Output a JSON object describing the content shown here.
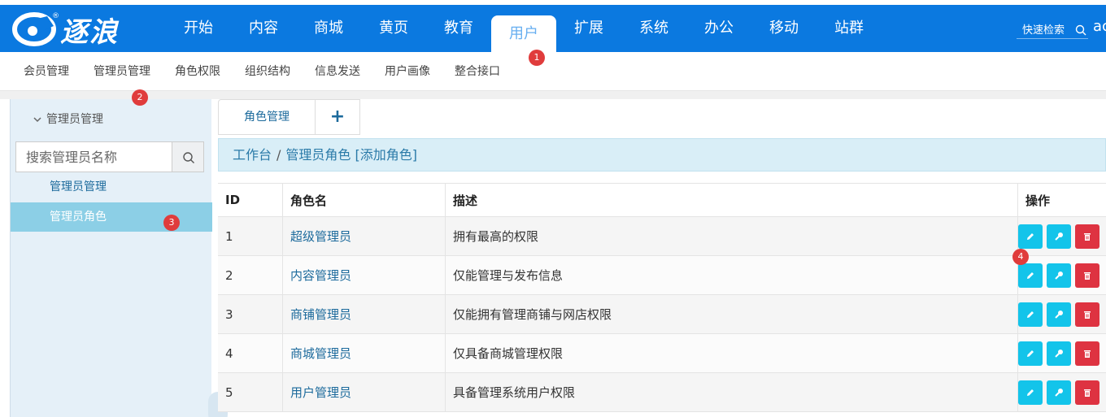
{
  "logo": {
    "text": "逐浪"
  },
  "nav": {
    "items": [
      "开始",
      "内容",
      "商城",
      "黄页",
      "教育",
      "用户",
      "扩展",
      "系统",
      "办公",
      "移动",
      "站群"
    ],
    "active": "用户"
  },
  "quick_search": {
    "label": "快速检索",
    "user_truncated": "ac"
  },
  "subnav": {
    "items": [
      "会员管理",
      "管理员管理",
      "角色权限",
      "组织结构",
      "信息发送",
      "用户画像",
      "整合接口"
    ]
  },
  "badges": {
    "b1": "1",
    "b2": "2",
    "b3": "3",
    "b4": "4"
  },
  "sidebar": {
    "heading": "管理员管理",
    "search_placeholder": "搜索管理员名称",
    "items": [
      {
        "label": "管理员管理",
        "active": false
      },
      {
        "label": "管理员角色",
        "active": true
      }
    ]
  },
  "tabs": {
    "current": "角色管理",
    "add": "+"
  },
  "breadcrumb": {
    "home": "工作台",
    "separator": "/",
    "current": "管理员角色 [添加角色]"
  },
  "table": {
    "headers": {
      "id": "ID",
      "name": "角色名",
      "desc": "描述",
      "ops": "操作"
    },
    "rows": [
      {
        "id": "1",
        "name": "超级管理员",
        "desc": "拥有最高的权限"
      },
      {
        "id": "2",
        "name": "内容管理员",
        "desc": "仅能管理与发布信息"
      },
      {
        "id": "3",
        "name": "商铺管理员",
        "desc": "仅能拥有管理商铺与网店权限"
      },
      {
        "id": "4",
        "name": "商城管理员",
        "desc": "仅具备商城管理权限"
      },
      {
        "id": "5",
        "name": "用户管理员",
        "desc": "具备管理系统用户权限"
      }
    ]
  },
  "colors": {
    "topbar": "#0b79e0",
    "sidebar": "#e5f0f8",
    "active_side": "#8ccfe6",
    "breadcrumb_bg": "#d9eef7",
    "op_cyan": "#13c4ea",
    "op_red": "#de3341",
    "badge": "#e03c3c"
  },
  "icons": [
    "logo-icon",
    "search-icon",
    "chevron-down-icon",
    "pencil-icon",
    "key-icon",
    "trash-icon"
  ]
}
